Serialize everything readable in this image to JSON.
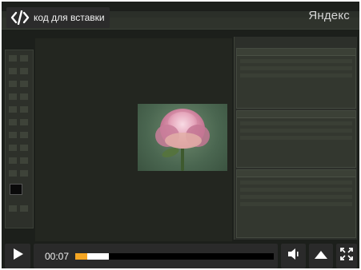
{
  "embed": {
    "label": "код для вставки",
    "icon": "code-icon"
  },
  "brand": {
    "name": "Яндекс"
  },
  "player": {
    "current_time": "00:07",
    "progress_played": 0.06,
    "progress_buffered": 0.17,
    "icons": {
      "play": "play-icon",
      "volume": "volume-icon",
      "share": "share-up-icon",
      "fullscreen": "fullscreen-icon"
    }
  },
  "colors": {
    "accent": "#f5a623",
    "control_bg": "#2a2a2a",
    "video_bg": "#1c1f1b"
  }
}
